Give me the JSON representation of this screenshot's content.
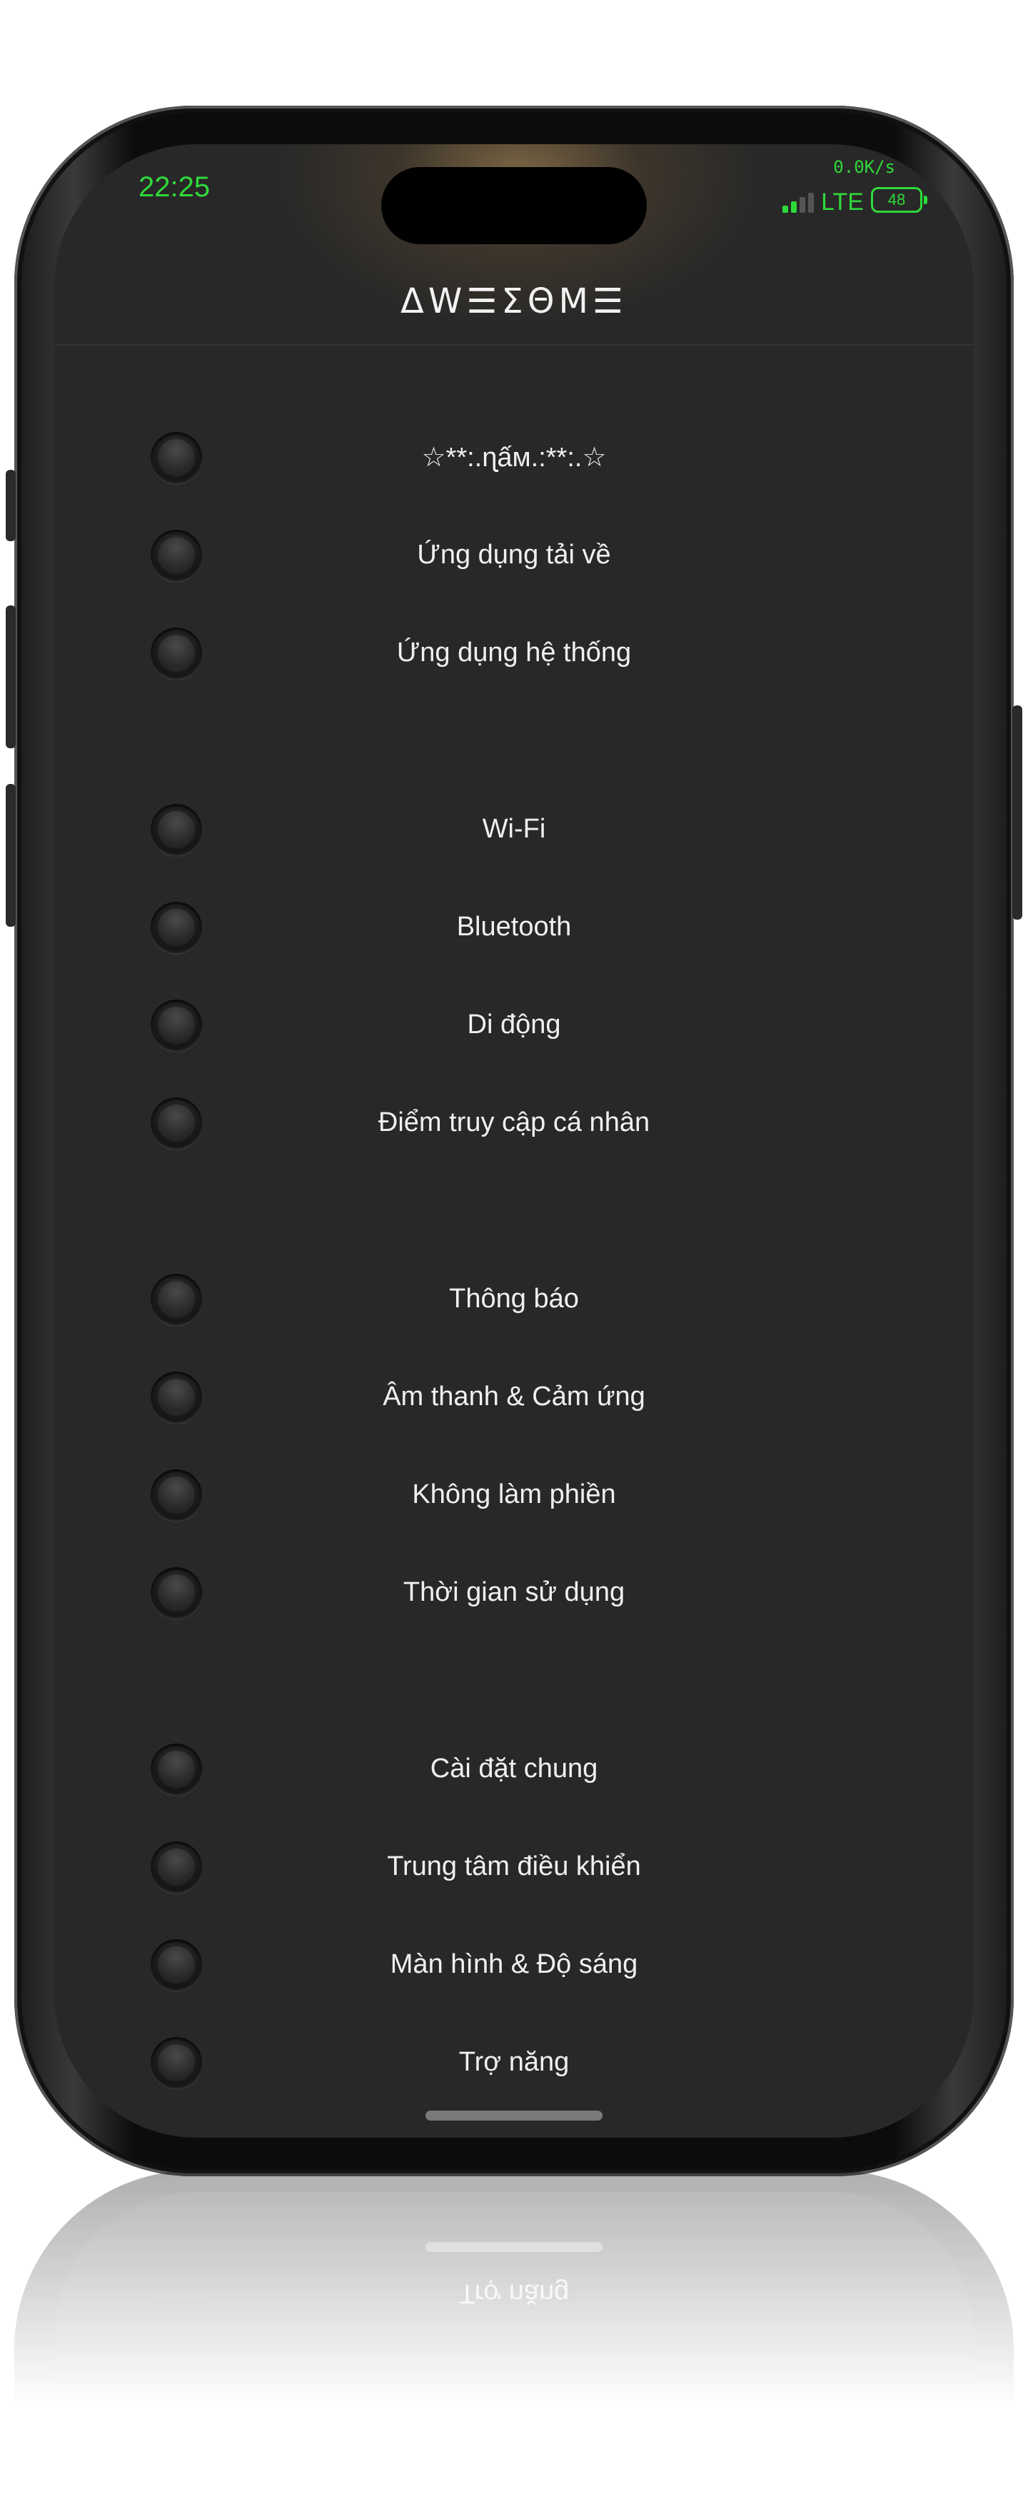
{
  "status_bar": {
    "time": "22:25",
    "net_speed": "0.0K/s",
    "carrier": "LTE",
    "battery": "48",
    "accent_color": "#30d93a",
    "signal_bars_active": 2,
    "signal_bars_total": 4
  },
  "nav": {
    "title": "ΔW☰ΣΘM☰"
  },
  "sections": [
    {
      "items": [
        {
          "label": "☆**:.ɳấм.:**:.☆"
        },
        {
          "label": "Ứng dụng tải về"
        },
        {
          "label": "Ứng dụng hệ thống"
        }
      ]
    },
    {
      "items": [
        {
          "label": "Wi-Fi"
        },
        {
          "label": "Bluetooth"
        },
        {
          "label": "Di động"
        },
        {
          "label": "Điểm truy cập cá nhân"
        }
      ]
    },
    {
      "items": [
        {
          "label": "Thông báo"
        },
        {
          "label": "Âm thanh & Cảm ứng"
        },
        {
          "label": "Không làm phiền"
        },
        {
          "label": "Thời gian sử dụng"
        }
      ]
    },
    {
      "items": [
        {
          "label": "Cài đặt chung"
        },
        {
          "label": "Trung tâm điều khiển"
        },
        {
          "label": "Màn hình & Độ sáng"
        },
        {
          "label": "Trợ năng"
        }
      ]
    }
  ],
  "reflection_label": "Trợ năng"
}
